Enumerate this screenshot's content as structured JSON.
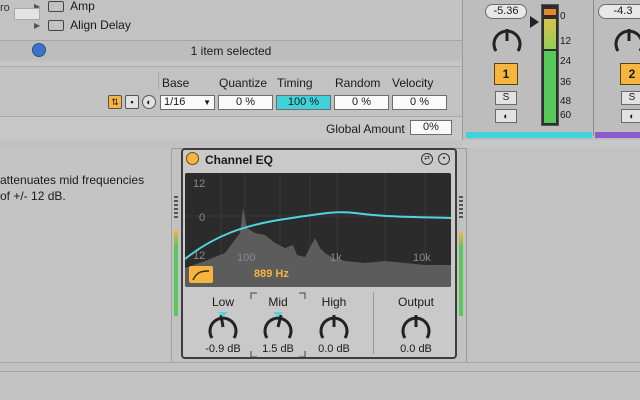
{
  "browser": {
    "items": [
      {
        "label": "Amp",
        "icon": "folder-icon"
      },
      {
        "label": "Align Delay",
        "icon": "device-icon"
      }
    ],
    "partial_left": "ro",
    "status": "1 item selected"
  },
  "groove": {
    "headers": {
      "base": "Base",
      "quantize": "Quantize",
      "timing": "Timing",
      "random": "Random",
      "velocity": "Velocity"
    },
    "base_value": "1/16",
    "quantize_value": "0 %",
    "timing_value": "100 %",
    "random_value": "0 %",
    "velocity_value": "0 %",
    "global_label": "Global Amount",
    "global_value": "0%"
  },
  "mixer": {
    "track1": {
      "volume": "-5.36",
      "number": "1",
      "solo": "S"
    },
    "track2": {
      "volume": "-4.3",
      "number": "2",
      "solo": "S"
    },
    "meter_scale": [
      "0",
      "12",
      "24",
      "36",
      "48",
      "60"
    ],
    "colors": {
      "track1": "#3fd2d9",
      "track2": "#8a5ccf",
      "active": "#f5b53e"
    }
  },
  "info": {
    "line1": "attenuates mid frequencies",
    "line2": "of +/- 12 dB."
  },
  "eq": {
    "title": "Channel EQ",
    "display": {
      "db_top": "12",
      "db_mid": "0",
      "db_bottom": "12",
      "freq_labels": [
        "100",
        "1k",
        "10k"
      ],
      "frequency": "889 Hz"
    },
    "knobs": {
      "low": {
        "label": "Low",
        "value": "-0.9 dB"
      },
      "mid": {
        "label": "Mid",
        "value": "1.5 dB"
      },
      "high": {
        "label": "High",
        "value": "0.0 dB"
      },
      "output": {
        "label": "Output",
        "value": "0.0 dB"
      }
    }
  }
}
